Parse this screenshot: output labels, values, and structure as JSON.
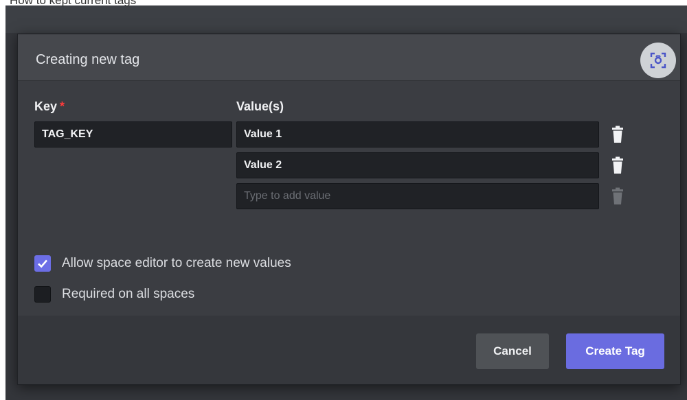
{
  "page": {
    "caption": "How to kept current tags"
  },
  "dialog": {
    "title": "Creating new tag",
    "capture_icon": "screenshot-capture-icon",
    "key": {
      "label": "Key",
      "required_marker": "*",
      "value": "TAG_KEY"
    },
    "values": {
      "label": "Value(s)",
      "items": [
        "Value 1",
        "Value 2"
      ],
      "new_placeholder": "Type to add value",
      "delete_icon": "trash-icon"
    },
    "options": [
      {
        "label": "Allow space editor to create new values",
        "checked": true
      },
      {
        "label": "Required on all spaces",
        "checked": false
      }
    ],
    "footer": {
      "cancel_label": "Cancel",
      "create_label": "Create Tag"
    }
  },
  "colors": {
    "accent": "#6a6ce0",
    "required": "#ff3b3b",
    "modal_bg": "#3b3d42",
    "header_bg": "#46484d",
    "input_bg": "#202226"
  }
}
